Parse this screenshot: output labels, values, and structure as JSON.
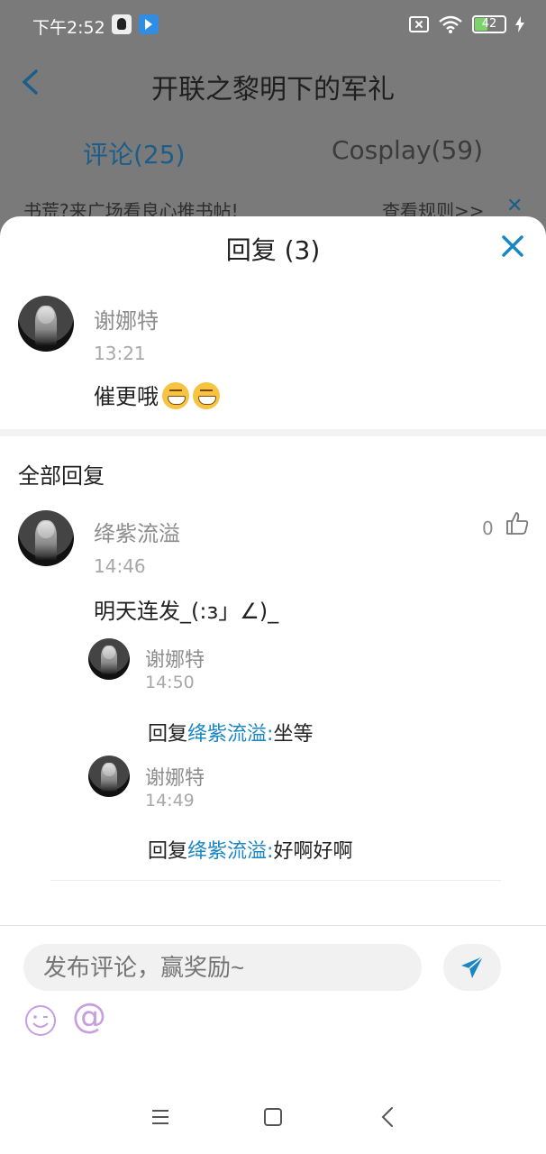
{
  "status_bar": {
    "time": "下午2:52",
    "battery": "42"
  },
  "header": {
    "title": "开联之黎明下的军礼"
  },
  "tabs": [
    {
      "label": "评论(25)",
      "active": true
    },
    {
      "label": "Cosplay(59)",
      "active": false
    }
  ],
  "banner": {
    "text": "书荒?来广场看良心推书帖!",
    "link": "查看规则>>"
  },
  "reply_sheet": {
    "title": "回复 (3)",
    "original_comment": {
      "username": "谢娜特",
      "time": "13:21",
      "text": "催更哦"
    },
    "section_title": "全部回复",
    "reply": {
      "username": "绛紫流溢",
      "time": "14:46",
      "text": "明天连发_(:з」∠)_",
      "like_count": "0",
      "sub_replies": [
        {
          "username": "谢娜特",
          "time": "14:50",
          "prefix": "回复",
          "target": "绛紫流溢:",
          "text": "坐等"
        },
        {
          "username": "谢娜特",
          "time": "14:49",
          "prefix": "回复",
          "target": "绛紫流溢:",
          "text": "好啊好啊"
        }
      ]
    }
  },
  "composer": {
    "placeholder": "发布评论，赢奖励~",
    "at_symbol": "@"
  },
  "colors": {
    "accent": "#1b86c4",
    "emoji_purple": "#c79ee0"
  }
}
